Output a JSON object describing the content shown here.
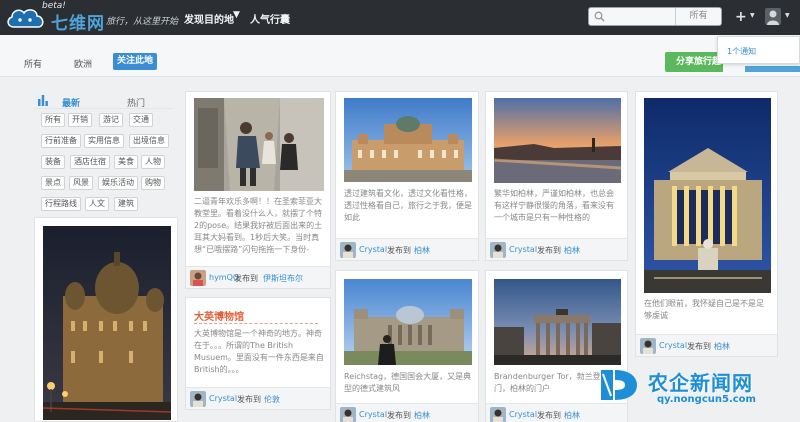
{
  "header": {
    "beta": "beta!",
    "site_name": "七维网",
    "slogan": "旅行，从这里开始",
    "nav_discover": "发现目的地",
    "nav_popular": "人气行囊",
    "search_placeholder": "",
    "search_scope": "所有",
    "brand_color": "#4ea3d9"
  },
  "notification": {
    "text": "1个通知"
  },
  "filter": {
    "all": "所有",
    "europe": "欧洲",
    "follow": "关注此地",
    "share": "分享旅行趣事"
  },
  "sidebar": {
    "tab_latest": "最新",
    "tab_hot": "热门",
    "tags": [
      "所有",
      "开销",
      "游记",
      "交通",
      "行前准备",
      "实用信息",
      "出境信息",
      "装备",
      "酒店住宿",
      "美食",
      "人物",
      "景点",
      "风景",
      "娱乐活动",
      "购物",
      "行程路线",
      "人文",
      "建筑"
    ]
  },
  "cards": {
    "hotel": {
      "desc": "二逼青年欢乐多啊！！在圣索菲亚大教堂里。看着没什么人，就摆了个特2的pose。结果我好被后面出来的土耳其大妈看到。1秒后大笑。当时真想“已哦摆路”闪句拖拖一下身份-_-!!!",
      "user": "hymQQ",
      "verb": "发布到",
      "place": "伊斯坦布尔"
    },
    "museum": {
      "title": "大英博物馆",
      "desc": "大英博物馆是一个神奇的地方。神奇在于。。。所谓的The British Musuem。里面没有一件东西是来自British的。。。",
      "user": "Crystal",
      "verb": "发布到",
      "place": "伦敦"
    },
    "palace": {
      "desc": "透过建筑看文化，透过文化看性格，透过性格看自己，旅行之于我，便是如此",
      "user": "Crystal",
      "verb": "发布到",
      "place": "柏林"
    },
    "river": {
      "desc": "繁华如柏林，严谨如柏林，也总会有这样宁静很慢的角落，看来没有一个城市是只有一种性格的",
      "user": "Crystal",
      "verb": "发布到",
      "place": "柏林"
    },
    "concert": {
      "desc": "在他们眼前，我怀疑自己是不是足够虔诚",
      "user": "Crystal",
      "verb": "发布到",
      "place": "柏林"
    },
    "reichstag": {
      "desc": "Reichstag，德国国会大厦，又是典型的德式建筑风",
      "user": "Crystal",
      "verb": "发布到",
      "place": "柏林"
    },
    "gate": {
      "desc": "Brandenburger Tor，勃兰登堡门，柏林的门户",
      "user": "Crystal",
      "verb": "发布到",
      "place": "柏林"
    }
  },
  "watermark": {
    "name": "农企新闻网",
    "url": "qy.nongcun5.com"
  }
}
